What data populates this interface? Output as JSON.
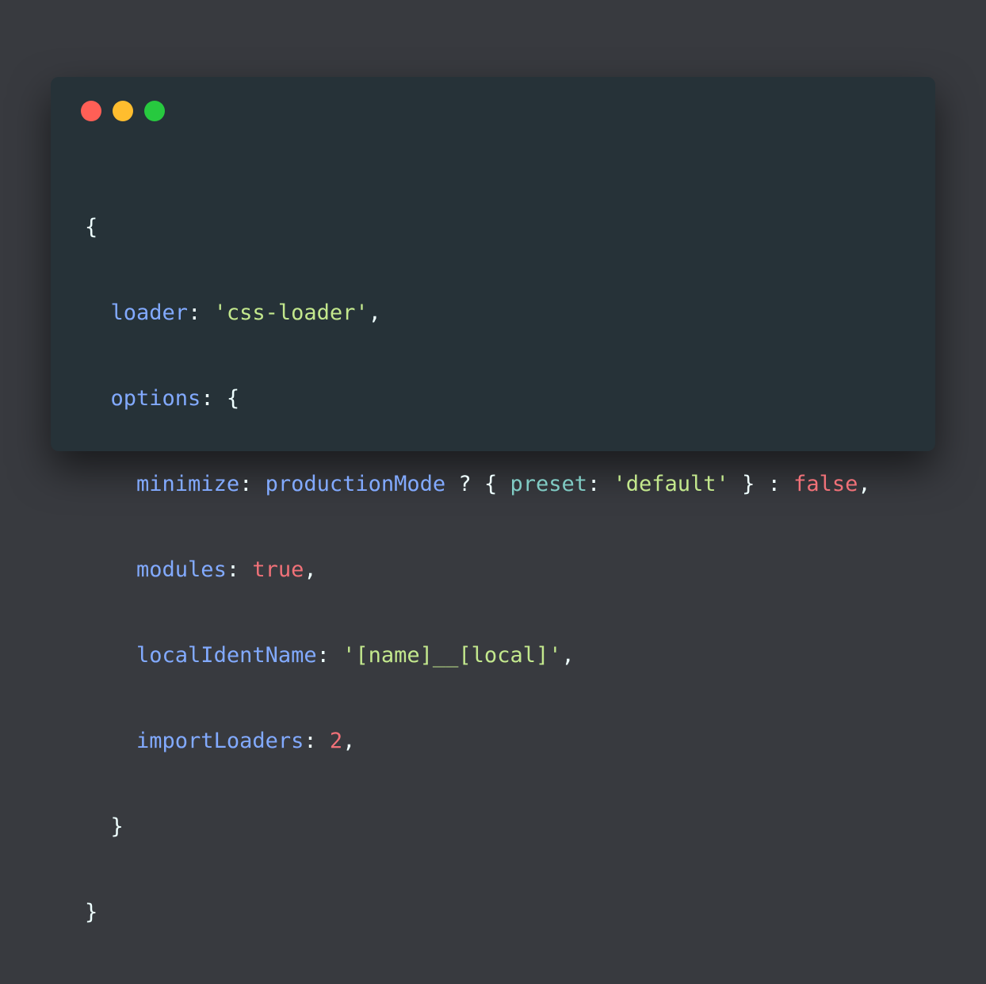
{
  "window": {
    "controls": [
      {
        "name": "close",
        "color": "#ff5f56"
      },
      {
        "name": "minimize",
        "color": "#ffbd2e"
      },
      {
        "name": "zoom",
        "color": "#27c93f"
      }
    ]
  },
  "code": {
    "open_brace": "{",
    "loader_key": "loader",
    "loader_value": "'css-loader'",
    "options_key": "options",
    "minimize_key": "minimize",
    "minimize_cond": "productionMode",
    "preset_key": "preset",
    "preset_value": "'default'",
    "minimize_else": "false",
    "modules_key": "modules",
    "modules_value": "true",
    "localIdentName_key": "localIdentName",
    "localIdentName_value": "'[name]__[local]'",
    "importLoaders_key": "importLoaders",
    "importLoaders_value": "2",
    "close_options": "}",
    "close_brace": "}"
  }
}
